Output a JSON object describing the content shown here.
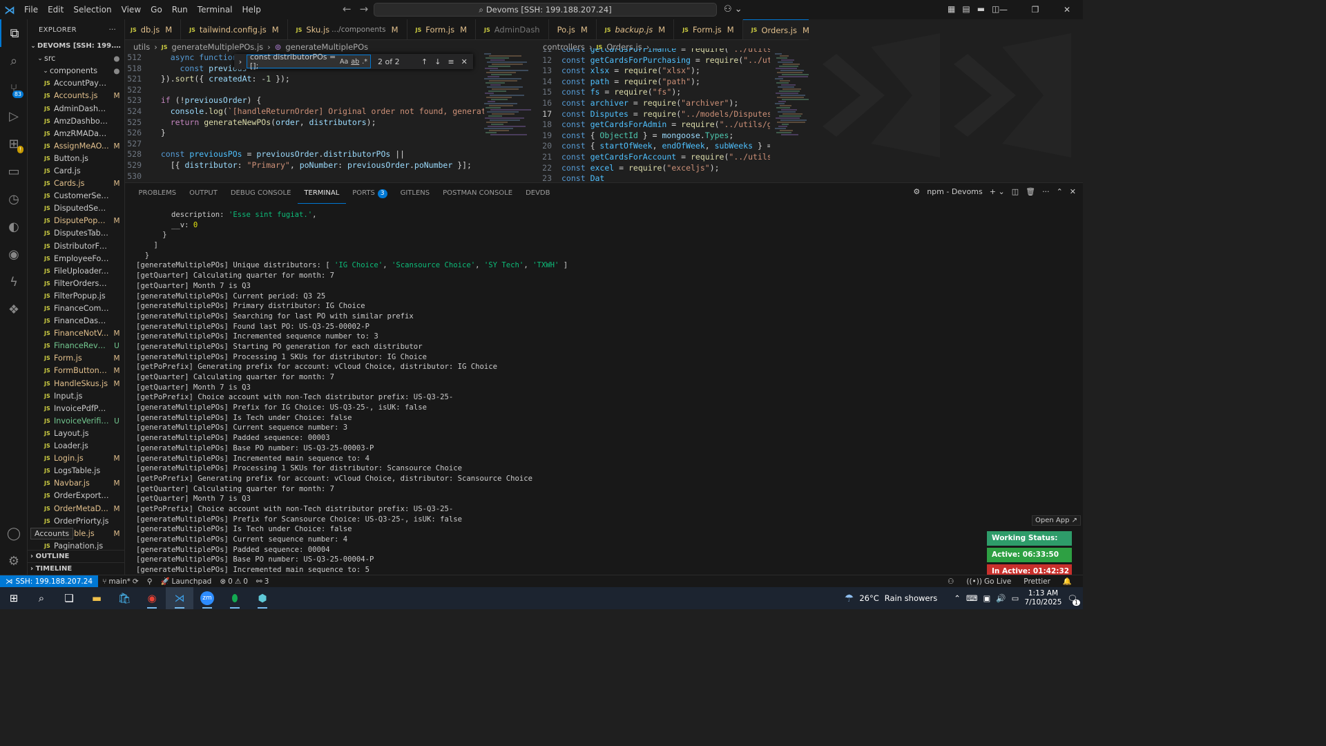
{
  "menu": [
    "File",
    "Edit",
    "Selection",
    "View",
    "Go",
    "Run",
    "Terminal",
    "Help"
  ],
  "command_center": "Devoms [SSH: 199.188.207.24]",
  "explorer": {
    "title": "EXPLORER",
    "root": "DEVOMS [SSH: 199.188.20...",
    "src": "src",
    "components": "components",
    "files": [
      {
        "name": "AccountPaymentP...",
        "st": "",
        "c": "n"
      },
      {
        "name": "Accounts.js",
        "st": "M",
        "c": "M"
      },
      {
        "name": "AdminDashboard.js",
        "st": "",
        "c": "n"
      },
      {
        "name": "AmzDashboard.js",
        "st": "",
        "c": "n"
      },
      {
        "name": "AmzRMADashboar...",
        "st": "",
        "c": "n"
      },
      {
        "name": "AssignMeAO...",
        "st": "M",
        "c": "M"
      },
      {
        "name": "Button.js",
        "st": "",
        "c": "n"
      },
      {
        "name": "Card.js",
        "st": "",
        "c": "n"
      },
      {
        "name": "Cards.js",
        "st": "M",
        "c": "M"
      },
      {
        "name": "CustomerSection.js",
        "st": "",
        "c": "n"
      },
      {
        "name": "DisputedSection.js",
        "st": "",
        "c": "n"
      },
      {
        "name": "DisputePopu...",
        "st": "M",
        "c": "M"
      },
      {
        "name": "DisputesTable.js",
        "st": "",
        "c": "n"
      },
      {
        "name": "DistributorForm.js",
        "st": "",
        "c": "n"
      },
      {
        "name": "EmployeeForm.js",
        "st": "",
        "c": "n"
      },
      {
        "name": "FileUploader.js",
        "st": "",
        "c": "n"
      },
      {
        "name": "FilterOrdersTable.js",
        "st": "",
        "c": "n"
      },
      {
        "name": "FilterPopup.js",
        "st": "",
        "c": "n"
      },
      {
        "name": "FinanceComments.js",
        "st": "",
        "c": "n"
      },
      {
        "name": "FinanceDashboard.js",
        "st": "",
        "c": "n"
      },
      {
        "name": "FinanceNotV...",
        "st": "M",
        "c": "M"
      },
      {
        "name": "FinanceReveri...",
        "st": "U",
        "c": "U"
      },
      {
        "name": "Form.js",
        "st": "M",
        "c": "M"
      },
      {
        "name": "FormButtons.js",
        "st": "M",
        "c": "M"
      },
      {
        "name": "HandleSkus.js",
        "st": "M",
        "c": "M"
      },
      {
        "name": "Input.js",
        "st": "",
        "c": "n"
      },
      {
        "name": "InvoicePdfPopup.js",
        "st": "",
        "c": "n"
      },
      {
        "name": "InvoiceVerific...",
        "st": "U",
        "c": "U"
      },
      {
        "name": "Layout.js",
        "st": "",
        "c": "n"
      },
      {
        "name": "Loader.js",
        "st": "",
        "c": "n"
      },
      {
        "name": "Login.js",
        "st": "M",
        "c": "M"
      },
      {
        "name": "LogsTable.js",
        "st": "",
        "c": "n"
      },
      {
        "name": "Navbar.js",
        "st": "M",
        "c": "M"
      },
      {
        "name": "OrderExportPopup.js",
        "st": "",
        "c": "n"
      },
      {
        "name": "OrderMetaD...",
        "st": "M",
        "c": "M"
      },
      {
        "name": "OrderPriorty.js",
        "st": "",
        "c": "n"
      },
      {
        "name": "ersTable.js",
        "st": "M",
        "c": "M"
      },
      {
        "name": "Pagination.js",
        "st": "",
        "c": "n"
      }
    ],
    "outline": "OUTLINE",
    "timeline": "TIMELINE"
  },
  "tooltip": "Accounts",
  "tabs": [
    {
      "name": "db.js",
      "st": "M",
      "ital": false,
      "active": false
    },
    {
      "name": "tailwind.config.js",
      "st": "M",
      "ital": false,
      "active": false
    },
    {
      "name": "Sku.js",
      "extra": ".../components",
      "st": "M",
      "ital": false,
      "active": false
    },
    {
      "name": "Form.js",
      "st": "M",
      "ital": false,
      "active": false
    },
    {
      "name": "AdminDash",
      "st": "",
      "ital": false,
      "active": false,
      "dim": true
    },
    {
      "name": "Po.js",
      "st": "M",
      "ital": false,
      "active": false,
      "nojs": true
    },
    {
      "name": "backup.js",
      "st": "M",
      "ital": true,
      "active": false
    },
    {
      "name": "Form.js",
      "st": "M",
      "ital": false,
      "active": false
    },
    {
      "name": "Orders.js",
      "st": "M",
      "ital": false,
      "active": true
    }
  ],
  "editor1": {
    "crumbs": [
      "utils",
      "generateMultiplePOs.js",
      "generateMultiplePOs"
    ],
    "find": {
      "query": "const distributorPOs = [];",
      "count": "2 of 2",
      "opt_case": "Aa",
      "opt_word": "ab",
      "opt_regex": ".*"
    }
  },
  "editor2": {
    "crumbs": [
      "controllers",
      "Orders.js",
      "..."
    ]
  },
  "panel": {
    "tabs": [
      "PROBLEMS",
      "OUTPUT",
      "DEBUG CONSOLE",
      "TERMINAL",
      "PORTS",
      "GITLENS",
      "POSTMAN CONSOLE",
      "DEVDB"
    ],
    "ports_badge": "3",
    "terminal_name": "npm - Devoms"
  },
  "terminal_lines": [
    "        description: 'Esse sint fugiat.',",
    "        __v: 0",
    "      }",
    "    ]",
    "  }",
    "[generateMultiplePOs] Unique distributors: [ 'IG Choice', 'Scansource Choice', 'SY Tech', 'TXWH' ]",
    "[getQuarter] Calculating quarter for month: 7",
    "[getQuarter] Month 7 is Q3",
    "[generateMultiplePOs] Current period: Q3 25",
    "[generateMultiplePOs] Primary distributor: IG Choice",
    "[generateMultiplePOs] Searching for last PO with similar prefix",
    "[generateMultiplePOs] Found last PO: US-Q3-25-00002-P",
    "[generateMultiplePOs] Incremented sequence number to: 3",
    "[generateMultiplePOs] Starting PO generation for each distributor",
    "[generateMultiplePOs] Processing 1 SKUs for distributor: IG Choice",
    "[getPoPrefix] Generating prefix for account: vCloud Choice, distributor: IG Choice",
    "[getQuarter] Calculating quarter for month: 7",
    "[getQuarter] Month 7 is Q3",
    "[getPoPrefix] Choice account with non-Tech distributor prefix: US-Q3-25-",
    "[generateMultiplePOs] Prefix for IG Choice: US-Q3-25-, isUK: false",
    "[generateMultiplePOs] Is Tech under Choice: false",
    "[generateMultiplePOs] Current sequence number: 3",
    "[generateMultiplePOs] Padded sequence: 00003",
    "[generateMultiplePOs] Base PO number: US-Q3-25-00003-P",
    "[generateMultiplePOs] Incremented main sequence to: 4",
    "[generateMultiplePOs] Processing 1 SKUs for distributor: Scansource Choice",
    "[getPoPrefix] Generating prefix for account: vCloud Choice, distributor: Scansource Choice",
    "[getQuarter] Calculating quarter for month: 7",
    "[getQuarter] Month 7 is Q3",
    "[getPoPrefix] Choice account with non-Tech distributor prefix: US-Q3-25-",
    "[generateMultiplePOs] Prefix for Scansource Choice: US-Q3-25-, isUK: false",
    "[generateMultiplePOs] Is Tech under Choice: false",
    "[generateMultiplePOs] Current sequence number: 4",
    "[generateMultiplePOs] Padded sequence: 00004",
    "[generateMultiplePOs] Base PO number: US-Q3-25-00004-P",
    "[generateMultiplePOs] Incremented main sequence to: 5"
  ],
  "widgets": {
    "open_app": "Open App ↗",
    "working": "Working Status: Active",
    "active": "Active: 06:33:50",
    "inactive": "In Active: 01:42:32",
    "colors": {
      "working": "#2e9c6a",
      "active": "#2ea043",
      "inactive": "#c9302c"
    }
  },
  "statusbar": {
    "remote": "SSH: 199.188.207.24",
    "branch": "main*",
    "launchpad": "Launchpad",
    "errors": "0",
    "warnings": "0",
    "ports": "3",
    "golive": "Go Live",
    "prettier": "Prettier"
  },
  "taskbar": {
    "weather_temp": "26°C",
    "weather_text": "Rain showers",
    "time": "1:13 AM",
    "date": "7/10/2025",
    "notif": "1"
  }
}
